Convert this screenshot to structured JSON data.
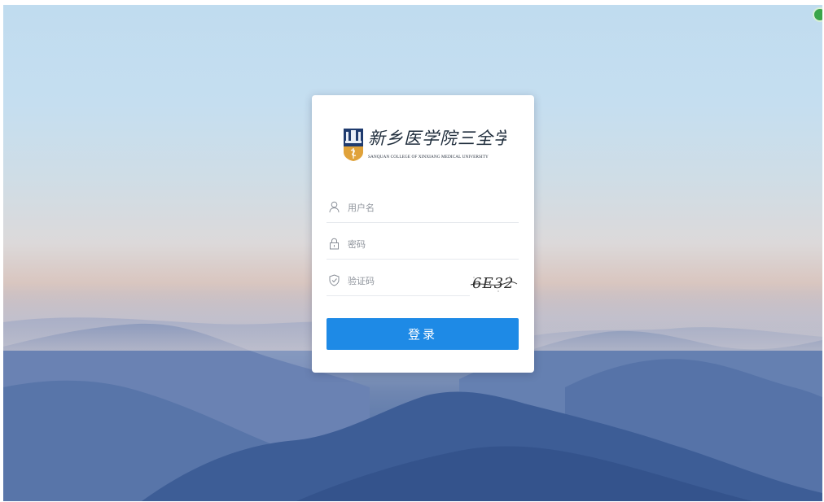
{
  "logo": {
    "name_cn": "新乡医学院三全学院",
    "name_en": "SANQUAN COLLEGE OF XINXIANG MEDICAL UNIVERSITY"
  },
  "form": {
    "username": {
      "placeholder": "用户名",
      "value": "",
      "icon": "user-icon"
    },
    "password": {
      "placeholder": "密码",
      "value": "",
      "icon": "lock-icon"
    },
    "captcha": {
      "placeholder": "验证码",
      "value": "",
      "icon": "shield-icon",
      "code": "6E32"
    },
    "submit_label": "登录"
  },
  "colors": {
    "accent": "#1e8ae6",
    "sky_top": "#c0dcef",
    "mountain": "#4b6aa0"
  }
}
